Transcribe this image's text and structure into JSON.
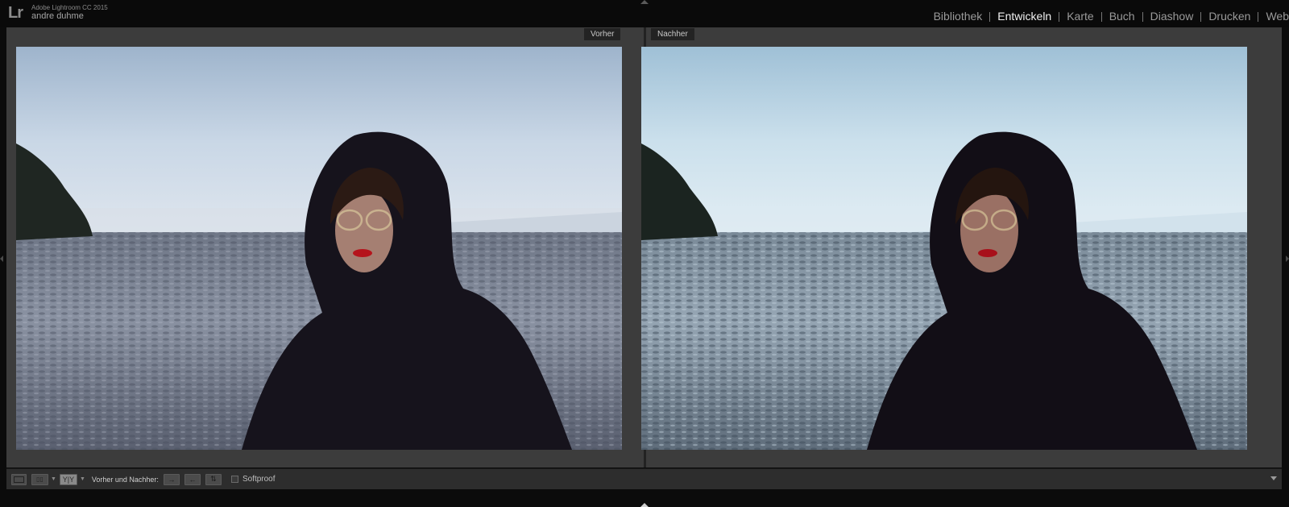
{
  "identity": {
    "logo": "Lr",
    "app_name": "Adobe Lightroom CC 2015",
    "user_name": "andre duhme"
  },
  "modules": [
    {
      "label": "Bibliothek",
      "active": false
    },
    {
      "label": "Entwickeln",
      "active": true
    },
    {
      "label": "Karte",
      "active": false
    },
    {
      "label": "Buch",
      "active": false
    },
    {
      "label": "Diashow",
      "active": false
    },
    {
      "label": "Drucken",
      "active": false
    },
    {
      "label": "Web",
      "active": false
    }
  ],
  "panes": {
    "before_label": "Vorher",
    "after_label": "Nachher"
  },
  "toolbar": {
    "before_after_label": "Vorher und Nachher:",
    "softproof_label": "Softproof",
    "yy_label": "Y|Y",
    "softproof_checked": false
  },
  "colors": {
    "accent_active_module": "#f0f0f0",
    "module_inactive": "#9a9a9a",
    "workspace_bg": "#3c3c3c",
    "toolbar_bg": "#2d2d2d"
  }
}
